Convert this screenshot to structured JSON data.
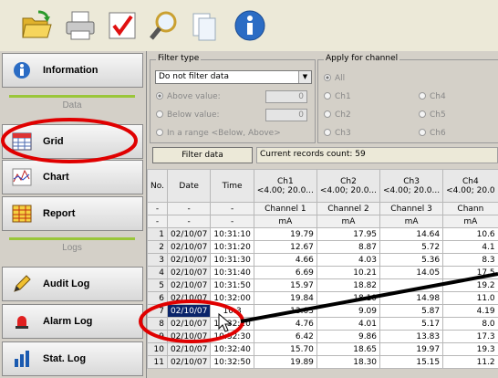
{
  "toolbar": {
    "icons": [
      "open-folder-icon",
      "print-icon",
      "check-icon",
      "search-icon",
      "document-icon",
      "info-icon"
    ]
  },
  "sidebar": {
    "information": "Information",
    "data_section": "Data",
    "grid": "Grid",
    "chart": "Chart",
    "report": "Report",
    "logs_section": "Logs",
    "audit_log": "Audit Log",
    "alarm_log": "Alarm Log",
    "stat_log": "Stat. Log"
  },
  "filter": {
    "title": "Filter type",
    "selected": "Do not filter data",
    "above": "Above value:",
    "below": "Below value:",
    "range": "In a range <Below, Above>",
    "above_value": "0",
    "below_value": "0"
  },
  "channel": {
    "title": "Apply for channel",
    "all": "All",
    "ch1": "Ch1",
    "ch2": "Ch2",
    "ch3": "Ch3",
    "ch4": "Ch4",
    "ch5": "Ch5",
    "ch6": "Ch6"
  },
  "filter_button": "Filter data",
  "records": "Current records count: 59",
  "grid": {
    "headers": {
      "no": "No.",
      "date": "Date",
      "time": "Time",
      "ch1": "Ch1",
      "ch1_range": "<4.00; 20.0...",
      "ch2": "Ch2",
      "ch2_range": "<4.00; 20.0...",
      "ch3": "Ch3",
      "ch3_range": "<4.00; 20.0...",
      "ch4": "Ch4",
      "ch4_range": "<4.00; 20.0"
    },
    "names": {
      "a": "-",
      "b": "-",
      "c": "-",
      "ch1": "Channel 1",
      "ch2": "Channel 2",
      "ch3": "Channel 3",
      "ch4": "Chann"
    },
    "units": {
      "a": "-",
      "b": "-",
      "c": "-",
      "ch1": "mA",
      "ch2": "mA",
      "ch3": "mA",
      "ch4": "mA"
    },
    "rows": [
      [
        "1",
        "02/10/07",
        "10:31:10",
        "19.79",
        "17.95",
        "14.64",
        "10.6"
      ],
      [
        "2",
        "02/10/07",
        "10:31:20",
        "12.67",
        "8.87",
        "5.72",
        "4.1"
      ],
      [
        "3",
        "02/10/07",
        "10:31:30",
        "4.66",
        "4.03",
        "5.36",
        "8.3"
      ],
      [
        "4",
        "02/10/07",
        "10:31:40",
        "6.69",
        "10.21",
        "14.05",
        "17.5"
      ],
      [
        "5",
        "02/10/07",
        "10:31:50",
        "15.97",
        "18.82",
        "",
        "19.2"
      ],
      [
        "6",
        "02/10/07",
        "10:32:00",
        "19.84",
        "18.10",
        "14.98",
        "11.0"
      ],
      [
        "7",
        "02/10/07",
        "10:3",
        "13.03",
        "9.09",
        "5.87",
        "4.19"
      ],
      [
        "8",
        "02/10/07",
        "10:32:20",
        "4.76",
        "4.01",
        "5.17",
        "8.0"
      ],
      [
        "9",
        "02/10/07",
        "10:32:30",
        "6.42",
        "9.86",
        "13.83",
        "17.3"
      ],
      [
        "10",
        "02/10/07",
        "10:32:40",
        "15.70",
        "18.65",
        "19.97",
        "19.3"
      ],
      [
        "11",
        "02/10/07",
        "10:32:50",
        "19.89",
        "18.30",
        "15.15",
        "11.2"
      ]
    ]
  }
}
